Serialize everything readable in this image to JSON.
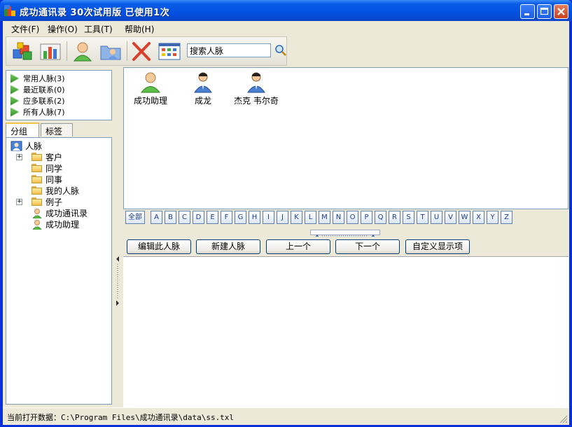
{
  "window": {
    "title": "成功通讯录  30次试用版  已使用1次",
    "minimize_icon": "minimize-icon",
    "maximize_icon": "maximize-icon",
    "close_icon": "close-icon"
  },
  "menu": [
    {
      "label": "文件(F)"
    },
    {
      "label": "操作(O)"
    },
    {
      "label": "工具(T)"
    },
    {
      "label": "帮助(H)"
    }
  ],
  "toolbar": {
    "buttons": [
      {
        "icon": "cubes-icon"
      },
      {
        "icon": "bar-chart-icon"
      },
      {
        "icon": "person-icon"
      },
      {
        "icon": "folder-people-icon"
      },
      {
        "icon": "delete-x-icon"
      },
      {
        "icon": "grid-view-icon"
      }
    ],
    "search_value": "搜索人脉",
    "search_icon": "magnifier-icon"
  },
  "quick_list": [
    {
      "label": "常用人脉(3)"
    },
    {
      "label": "最近联系(0)"
    },
    {
      "label": "应多联系(2)"
    },
    {
      "label": "所有人脉(7)"
    }
  ],
  "tabs": [
    {
      "label": "分组",
      "active": true
    },
    {
      "label": "标签",
      "active": false
    }
  ],
  "tree": {
    "root": "人脉",
    "items": [
      {
        "label": "客户",
        "type": "folder",
        "expandable": true
      },
      {
        "label": "同学",
        "type": "folder",
        "expandable": false
      },
      {
        "label": "同事",
        "type": "folder",
        "expandable": false
      },
      {
        "label": "我的人脉",
        "type": "folder",
        "expandable": false
      },
      {
        "label": "例子",
        "type": "folder",
        "expandable": true
      },
      {
        "label": "成功通讯录",
        "type": "contact",
        "expandable": false
      },
      {
        "label": "成功助理",
        "type": "contact",
        "expandable": false
      }
    ]
  },
  "contacts": [
    {
      "name": "成功助理",
      "icon": "green-person-icon"
    },
    {
      "name": "成龙",
      "icon": "businessman-icon"
    },
    {
      "name": "杰克 韦尔奇",
      "icon": "businessman-icon"
    }
  ],
  "alphabet": {
    "all_label": "全部",
    "letters": [
      "A",
      "B",
      "C",
      "D",
      "E",
      "F",
      "G",
      "H",
      "I",
      "J",
      "K",
      "L",
      "M",
      "N",
      "O",
      "P",
      "Q",
      "R",
      "S",
      "T",
      "U",
      "V",
      "W",
      "X",
      "Y",
      "Z"
    ]
  },
  "actions": {
    "edit": "编辑此人脉",
    "new": "新建人脉",
    "prev": "上一个",
    "next": "下一个",
    "customize": "自定义显示项"
  },
  "status": {
    "label": "当前打开数据：",
    "path": "C:\\Program Files\\成功通讯录\\data\\ss.txl"
  }
}
